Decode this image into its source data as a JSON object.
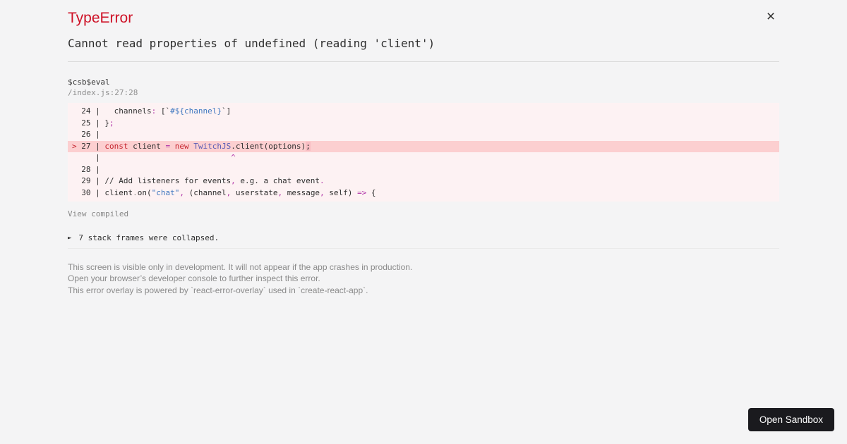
{
  "colors": {
    "page_background": "#f4f4f5",
    "accent_red": "#ce1126",
    "text_dark": "#2f2f2f",
    "text_gray": "#878787",
    "divider": "#dadada"
  },
  "overlay": {
    "title": "TypeError",
    "message": "Cannot read properties of undefined (reading 'client')",
    "close_icon": "×"
  },
  "stack_frame": {
    "function_name": "$csb$eval",
    "location": "/index.js:27:28"
  },
  "code_frame": {
    "background": "#fdf2f3",
    "highlight_background": "#fccfd0",
    "loc_background": "#f8bdc3",
    "token_colors": {
      "plain": "#2f2f2f",
      "keyword": "#c5232e",
      "class": "#5a5cb5",
      "string": "#4078c0",
      "operator": "#b135a8",
      "gray": "#8f8f8f",
      "marker": "#c5232e"
    },
    "lines": [
      {
        "highlight": false,
        "tokens": [
          [
            "  24 | ",
            "plain"
          ],
          [
            "  channels",
            "plain"
          ],
          [
            ":",
            "operator"
          ],
          [
            " [",
            "plain"
          ],
          [
            "`",
            "plain"
          ],
          [
            "#${channel}",
            "string"
          ],
          [
            "`",
            "plain"
          ],
          [
            "]",
            "plain"
          ]
        ]
      },
      {
        "highlight": false,
        "tokens": [
          [
            "  25 | ",
            "plain"
          ],
          [
            "}",
            "plain"
          ],
          [
            ";",
            "operator"
          ]
        ]
      },
      {
        "highlight": false,
        "tokens": [
          [
            "  26 |",
            "plain"
          ]
        ]
      },
      {
        "highlight": true,
        "tokens": [
          [
            ">",
            "marker"
          ],
          [
            " 27 | ",
            "plain"
          ],
          [
            "const",
            "keyword"
          ],
          [
            " client ",
            "plain"
          ],
          [
            "=",
            "operator"
          ],
          [
            " ",
            "plain"
          ],
          [
            "new",
            "keyword"
          ],
          [
            " ",
            "plain"
          ],
          [
            "TwitchJS",
            "class"
          ],
          [
            ".client(options)",
            "plain"
          ],
          [
            ";",
            "loc"
          ]
        ]
      },
      {
        "highlight": false,
        "tokens": [
          [
            "     | ",
            "plain"
          ],
          [
            "                           ",
            "plain"
          ],
          [
            "^",
            "operator"
          ]
        ]
      },
      {
        "highlight": false,
        "tokens": [
          [
            "  28 |",
            "plain"
          ]
        ]
      },
      {
        "highlight": false,
        "tokens": [
          [
            "  29 | ",
            "plain"
          ],
          [
            "// Add listeners for events",
            "plain"
          ],
          [
            ",",
            "operator"
          ],
          [
            " e.g. a chat event",
            "plain"
          ],
          [
            ".",
            "operator"
          ]
        ]
      },
      {
        "highlight": false,
        "tokens": [
          [
            "  30 | ",
            "plain"
          ],
          [
            "client",
            "plain"
          ],
          [
            ".",
            "gray"
          ],
          [
            "on(",
            "plain"
          ],
          [
            "\"chat\"",
            "string"
          ],
          [
            ",",
            "operator"
          ],
          [
            " (channel",
            "plain"
          ],
          [
            ",",
            "operator"
          ],
          [
            " userstate",
            "plain"
          ],
          [
            ",",
            "operator"
          ],
          [
            " message",
            "plain"
          ],
          [
            ",",
            "operator"
          ],
          [
            " self)",
            "plain"
          ],
          [
            " ",
            "plain"
          ],
          [
            "=>",
            "operator"
          ],
          [
            " {",
            "plain"
          ]
        ]
      }
    ]
  },
  "actions": {
    "view_compiled": "View compiled"
  },
  "collapsed_frames": {
    "arrow": "►",
    "text": "7 stack frames were collapsed."
  },
  "footer": {
    "lines": [
      "This screen is visible only in development. It will not appear if the app crashes in production.",
      "Open your browser’s developer console to further inspect this error.",
      "This error overlay is powered by `react-error-overlay` used in `create-react-app`."
    ]
  },
  "sandbox_button": {
    "label": "Open Sandbox",
    "background": "#1a1a1e"
  }
}
